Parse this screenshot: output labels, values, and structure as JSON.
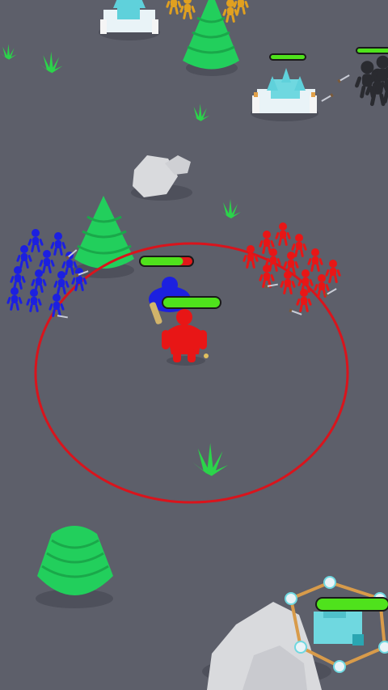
{
  "colors": {
    "ground": "#5d5f6a",
    "player_team": "#e81616",
    "enemy_team": "#1c20e0",
    "neutral_dark": "#2a2b30",
    "gold_team": "#e0a020",
    "tree": "#22cf5c",
    "grass": "#2bd44a",
    "rock": "#d9dadd",
    "health_fill": "#4fe21c",
    "health_empty": "#e21818",
    "battle_ring": "#d9141c"
  },
  "health": {
    "player_hero": 1.0,
    "enemy_hero": 0.82,
    "castle_top_right": 1.0,
    "dark_army": 1.0,
    "player_base": 1.0
  },
  "icons": {
    "castle": "ice-castle-icon",
    "base": "crystal-base-icon",
    "tree": "pine-tree-icon",
    "rock": "boulder-icon",
    "grass": "grass-tuft-icon"
  }
}
